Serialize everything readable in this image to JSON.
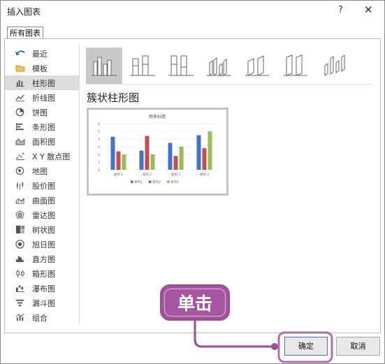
{
  "dialog": {
    "title": "插入图表",
    "help": "?",
    "close": "✕"
  },
  "tab": {
    "label": "所有图表"
  },
  "sidebar": {
    "items": [
      {
        "label": "最近",
        "icon": "recent-icon"
      },
      {
        "label": "模板",
        "icon": "folder-icon"
      },
      {
        "label": "柱形图",
        "icon": "column-chart-icon",
        "selected": true
      },
      {
        "label": "折线图",
        "icon": "line-chart-icon"
      },
      {
        "label": "饼图",
        "icon": "pie-chart-icon"
      },
      {
        "label": "条形图",
        "icon": "bar-chart-icon"
      },
      {
        "label": "面积图",
        "icon": "area-chart-icon"
      },
      {
        "label": "X Y 散点图",
        "icon": "scatter-chart-icon"
      },
      {
        "label": "地图",
        "icon": "map-chart-icon"
      },
      {
        "label": "股价图",
        "icon": "stock-chart-icon"
      },
      {
        "label": "曲面图",
        "icon": "surface-chart-icon"
      },
      {
        "label": "雷达图",
        "icon": "radar-chart-icon"
      },
      {
        "label": "树状图",
        "icon": "treemap-chart-icon"
      },
      {
        "label": "旭日图",
        "icon": "sunburst-chart-icon"
      },
      {
        "label": "直方图",
        "icon": "histogram-chart-icon"
      },
      {
        "label": "箱形图",
        "icon": "boxwhisker-chart-icon"
      },
      {
        "label": "瀑布图",
        "icon": "waterfall-chart-icon"
      },
      {
        "label": "漏斗图",
        "icon": "funnel-chart-icon"
      },
      {
        "label": "组合",
        "icon": "combo-chart-icon"
      }
    ]
  },
  "main": {
    "chart_name": "簇状柱形图"
  },
  "preview": {
    "chart_data": {
      "type": "bar",
      "title": "图表标题",
      "categories": [
        "类别 1",
        "类别 2",
        "类别 3",
        "类别 4"
      ],
      "series": [
        {
          "name": "系列1",
          "values": [
            4.3,
            2.5,
            3.5,
            4.5
          ]
        },
        {
          "name": "系列2",
          "values": [
            2.4,
            4.4,
            1.8,
            2.8
          ]
        },
        {
          "name": "系列3",
          "values": [
            2.0,
            2.0,
            3.0,
            5.0
          ]
        }
      ],
      "ylim": [
        0,
        6
      ],
      "yticks": [
        "0",
        "1",
        "2",
        "3",
        "4",
        "5",
        "6"
      ],
      "legend": "bottom",
      "grid": true,
      "colors": [
        "#4472c4",
        "#c0504d",
        "#9bbb59"
      ]
    }
  },
  "buttons": {
    "ok": "确定",
    "cancel": "取消"
  },
  "callout": {
    "text": "单击",
    "color": "#a6559f"
  }
}
